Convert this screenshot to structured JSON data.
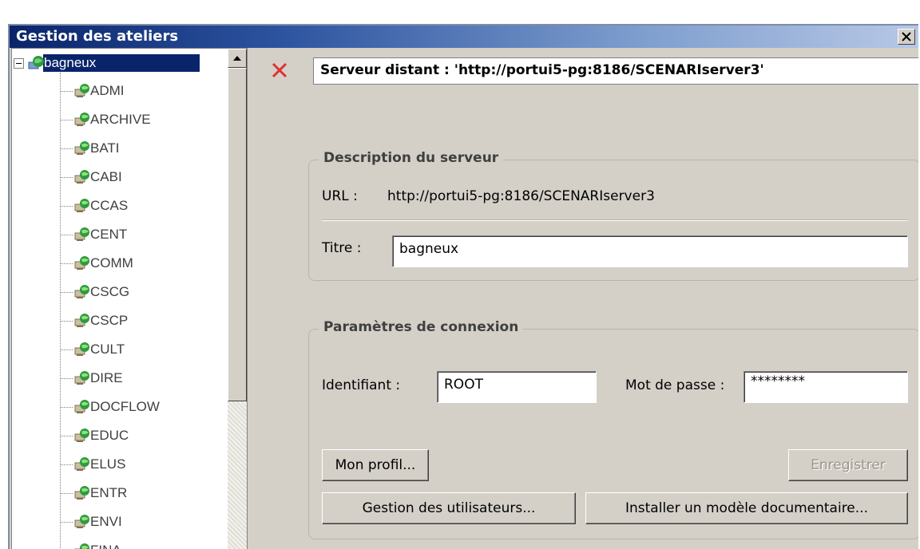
{
  "window": {
    "title": "Gestion des ateliers",
    "close_glyph": "✕"
  },
  "tree": {
    "root": {
      "label": "bagneux",
      "icon": "network-globe-icon"
    },
    "children": [
      "ADMI",
      "ARCHIVE",
      "BATI",
      "CABI",
      "CCAS",
      "CENT",
      "COMM",
      "CSCG",
      "CSCP",
      "CULT",
      "DIRE",
      "DOCFLOW",
      "EDUC",
      "ELUS",
      "ENTR",
      "ENVI",
      "FINA"
    ],
    "scroll_up_glyph": "▲"
  },
  "server": {
    "title": "Serveur distant : 'http://portui5-pg:8186/SCENARIserver3'"
  },
  "description": {
    "legend": "Description du serveur",
    "url_label": "URL :",
    "url_value": "http://portui5-pg:8186/SCENARIserver3",
    "title_label": "Titre :",
    "title_value": "bagneux"
  },
  "connection": {
    "legend": "Paramètres de connexion",
    "id_label": "Identifiant :",
    "id_value": "ROOT",
    "password_label": "Mot de passe :",
    "password_value": "********"
  },
  "buttons": {
    "profile": "Mon profil...",
    "save": "Enregistrer",
    "users": "Gestion des utilisateurs...",
    "install_model": "Installer un modèle documentaire..."
  },
  "colors": {
    "selection": "#0a246a",
    "window_bg": "#d4d0c8",
    "delete_red": "#e03030"
  }
}
